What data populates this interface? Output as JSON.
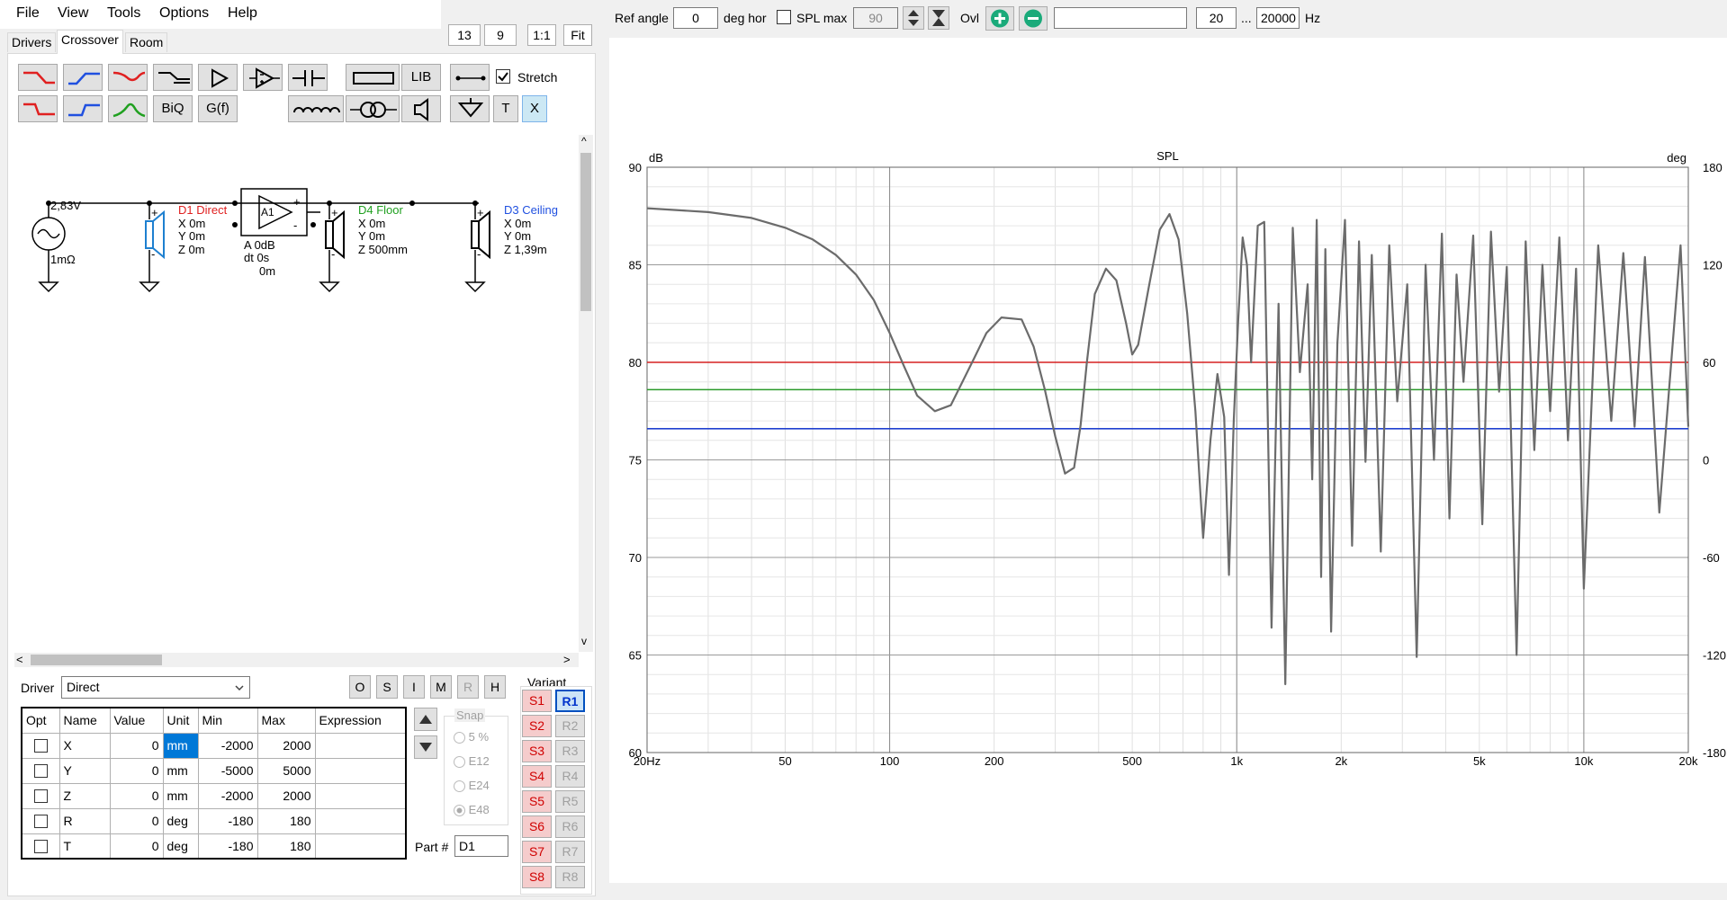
{
  "menu": [
    "File",
    "View",
    "Tools",
    "Options",
    "Help"
  ],
  "top_buttons": {
    "n1": "13",
    "n2": "9",
    "ratio": "1:1",
    "fit": "Fit"
  },
  "tabs": [
    "Drivers",
    "Crossover",
    "Room"
  ],
  "toolbar": {
    "lib": "LIB",
    "stretch": "Stretch",
    "biq": "BiQ",
    "gf": "G(f)",
    "t": "T",
    "x": "X"
  },
  "schematic": {
    "source_v": "2,83V",
    "source_r": "1mΩ",
    "d1": {
      "name": "D1 Direct",
      "x": "X 0m",
      "y": "Y 0m",
      "z": "Z 0m"
    },
    "amp": {
      "name": "A1",
      "gain": "A  0dB",
      "dt": "dt 0s",
      "dist": "0m"
    },
    "d4": {
      "name": "D4 Floor",
      "x": "X 0m",
      "y": "Y 0m",
      "z": "Z 500mm"
    },
    "d3": {
      "name": "D3 Ceiling",
      "x": "X 0m",
      "y": "Y 0m",
      "z": "Z 1,39m"
    },
    "plus": "+",
    "minus": "-"
  },
  "driver": {
    "label": "Driver",
    "value": "Direct"
  },
  "osim": [
    "O",
    "S",
    "I",
    "M",
    "R",
    "H"
  ],
  "grid": {
    "headers": [
      "Opt",
      "Name",
      "Value",
      "Unit",
      "Min",
      "Max",
      "Expression"
    ],
    "rows": [
      {
        "name": "X",
        "value": "0",
        "unit": "mm",
        "min": "-2000",
        "max": "2000"
      },
      {
        "name": "Y",
        "value": "0",
        "unit": "mm",
        "min": "-5000",
        "max": "5000"
      },
      {
        "name": "Z",
        "value": "0",
        "unit": "mm",
        "min": "-2000",
        "max": "2000"
      },
      {
        "name": "R",
        "value": "0",
        "unit": "deg",
        "min": "-180",
        "max": "180"
      },
      {
        "name": "T",
        "value": "0",
        "unit": "deg",
        "min": "-180",
        "max": "180"
      }
    ]
  },
  "snap": {
    "label": "Snap",
    "options": [
      "5 %",
      "E12",
      "E24",
      "E48"
    ]
  },
  "part": {
    "label": "Part #",
    "value": "D1"
  },
  "variant": {
    "label": "Variant",
    "s": [
      "S1",
      "S2",
      "S3",
      "S4",
      "S5",
      "S6",
      "S7",
      "S8"
    ],
    "r": [
      "R1",
      "R2",
      "R3",
      "R4",
      "R5",
      "R6",
      "R7",
      "R8"
    ]
  },
  "topbar": {
    "ref_angle_label": "Ref angle",
    "ref_angle": "0",
    "deg_hor": "deg hor",
    "spl_max_label": "SPL max",
    "spl_max": "90",
    "ovl": "Ovl",
    "fmin": "20",
    "dots": "...",
    "fmax": "20000",
    "hz": "Hz"
  },
  "chart_data": {
    "type": "line",
    "title": "SPL",
    "ylabel": "dB",
    "y2label": "deg",
    "ylim": [
      60,
      90
    ],
    "y2lim": [
      -180,
      180
    ],
    "xlim": [
      20,
      20000
    ],
    "xscale": "log",
    "yticks": [
      "90",
      "85",
      "80",
      "75",
      "70",
      "65",
      "60"
    ],
    "y2ticks": [
      "180",
      "120",
      "60",
      "0",
      "-60",
      "-120",
      "-180"
    ],
    "xticks": [
      {
        "v": 20,
        "l": "20Hz"
      },
      {
        "v": 50,
        "l": "50"
      },
      {
        "v": 100,
        "l": "100"
      },
      {
        "v": 200,
        "l": "200"
      },
      {
        "v": 500,
        "l": "500"
      },
      {
        "v": 1000,
        "l": "1k"
      },
      {
        "v": 2000,
        "l": "2k"
      },
      {
        "v": 5000,
        "l": "5k"
      },
      {
        "v": 10000,
        "l": "10k"
      },
      {
        "v": 20000,
        "l": "20k"
      }
    ],
    "hlines": [
      {
        "y": 80,
        "color": "#d62020"
      },
      {
        "y": 78.6,
        "color": "#2a9a2a"
      },
      {
        "y": 76.6,
        "color": "#2040d0"
      }
    ],
    "series": [
      {
        "color": "#6b6b6b",
        "x": [
          20,
          30,
          40,
          50,
          60,
          70,
          80,
          90,
          100,
          110,
          120,
          135,
          150,
          160,
          175,
          190,
          210,
          240,
          260,
          280,
          300,
          320,
          340,
          355,
          370,
          390,
          420,
          450,
          480,
          500,
          520,
          560,
          600,
          640,
          680,
          720,
          760,
          800,
          840,
          880,
          920,
          950,
          980,
          1010,
          1040,
          1070,
          1100,
          1150,
          1200,
          1260,
          1320,
          1380,
          1450,
          1520,
          1600,
          1650,
          1700,
          1750,
          1800,
          1870,
          1950,
          2050,
          2150,
          2250,
          2350,
          2450,
          2600,
          2750,
          2900,
          3100,
          3300,
          3500,
          3700,
          3900,
          4100,
          4300,
          4500,
          4800,
          5100,
          5400,
          5700,
          6000,
          6400,
          6800,
          7200,
          7600,
          8000,
          8500,
          9000,
          9500,
          10000,
          11000,
          12000,
          13000,
          14000,
          15000,
          16500,
          18000,
          19000,
          20000
        ],
        "y": [
          87.9,
          87.7,
          87.4,
          86.9,
          86.3,
          85.5,
          84.5,
          83.2,
          81.5,
          79.8,
          78.3,
          77.5,
          77.8,
          78.8,
          80.2,
          81.5,
          82.3,
          82.2,
          80.8,
          78.6,
          76.2,
          74.3,
          74.6,
          76.8,
          80.0,
          83.5,
          84.8,
          84.2,
          82.0,
          80.4,
          80.9,
          84.0,
          86.8,
          87.6,
          86.3,
          82.5,
          77.5,
          71.0,
          76.0,
          79.4,
          77.2,
          69.1,
          77.0,
          82.2,
          86.4,
          85.0,
          80.0,
          87.0,
          87.2,
          66.4,
          83.0,
          63.5,
          86.9,
          79.5,
          84.0,
          74.0,
          87.3,
          69.0,
          85.8,
          66.2,
          81.0,
          87.3,
          70.6,
          86.2,
          74.9,
          85.5,
          70.3,
          86.0,
          78.0,
          84.0,
          64.9,
          85.0,
          75.0,
          86.6,
          72.0,
          84.5,
          79.0,
          86.5,
          71.7,
          86.7,
          78.5,
          84.9,
          65.0,
          86.2,
          75.5,
          85.0,
          77.5,
          86.4,
          76.0,
          84.8,
          68.4,
          86.0,
          77.0,
          85.6,
          76.7,
          85.4,
          72.3,
          80.8,
          86.0,
          76.7
        ]
      }
    ]
  }
}
